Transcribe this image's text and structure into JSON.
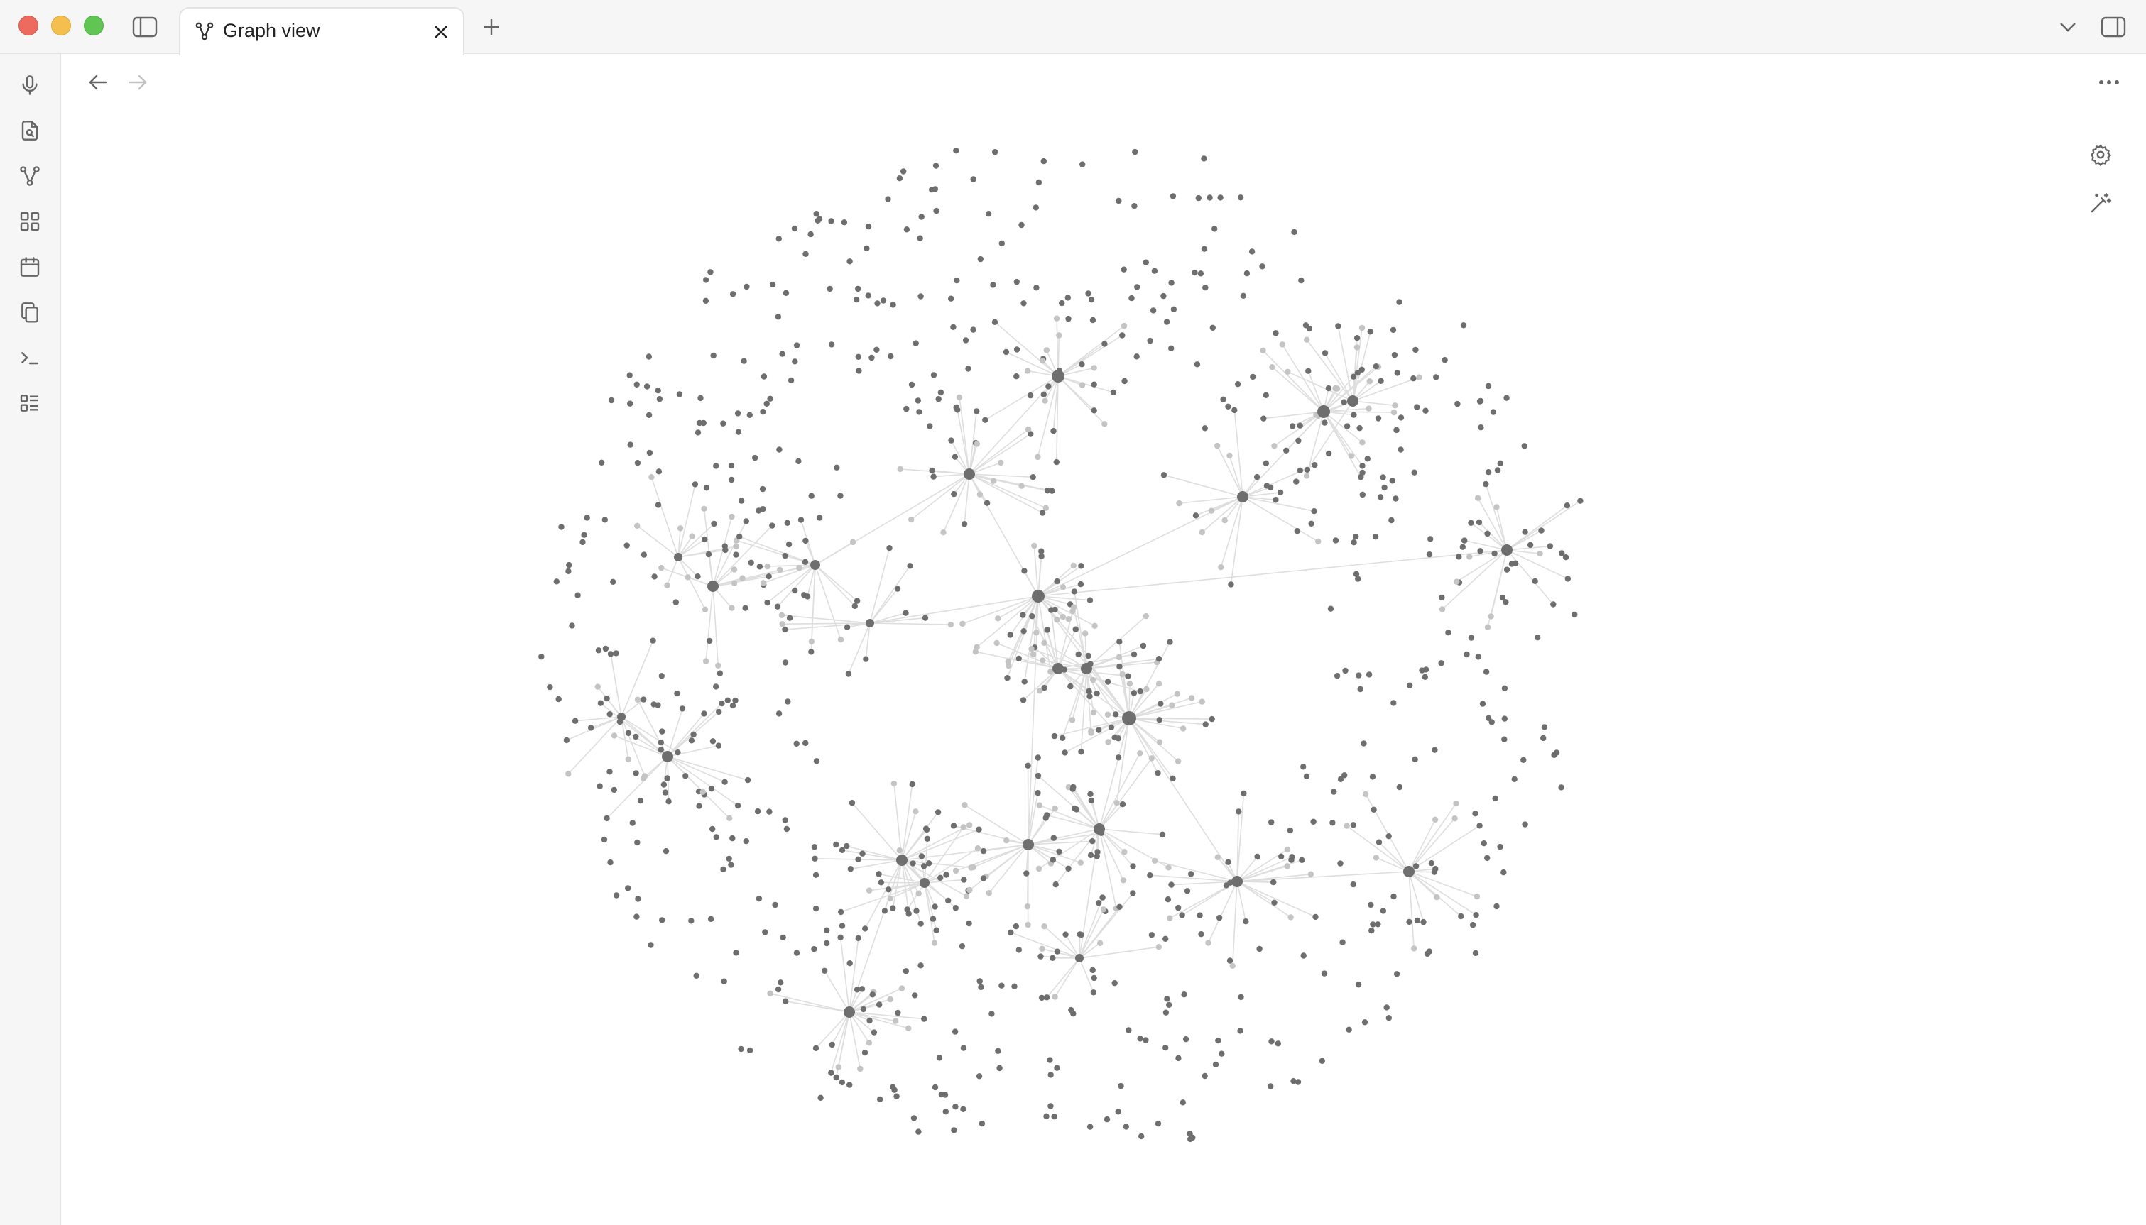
{
  "tab": {
    "title": "Graph view",
    "icon": "graph-icon"
  },
  "toolbar": {
    "sidebar_toggle_icon": "sidebar-toggle-icon",
    "new_tab_icon": "plus-icon",
    "tab_list_icon": "chevron-down-icon",
    "right_sidebar_icon": "right-sidebar-icon"
  },
  "ribbon": {
    "items": [
      {
        "name": "record-audio",
        "icon": "microphone-icon"
      },
      {
        "name": "search-file",
        "icon": "file-search-icon"
      },
      {
        "name": "graph-view",
        "icon": "graph-icon"
      },
      {
        "name": "canvas",
        "icon": "layout-dashboard-icon"
      },
      {
        "name": "daily-notes",
        "icon": "calendar-icon"
      },
      {
        "name": "templates",
        "icon": "copy-icon"
      },
      {
        "name": "command-palette",
        "icon": "terminal-icon"
      },
      {
        "name": "bases",
        "icon": "list-icon"
      }
    ]
  },
  "view_header": {
    "back_icon": "arrow-left-icon",
    "forward_icon": "arrow-right-icon",
    "more_icon": "more-horizontal-icon"
  },
  "graph_controls": {
    "settings_icon": "gear-icon",
    "animate_icon": "magic-wand-icon"
  },
  "colors": {
    "node": "#6e6e6e",
    "node_faded": "#c4c4c4",
    "edge": "#dedede",
    "chrome_bg": "#f6f6f6",
    "border": "#e3e3e3"
  }
}
